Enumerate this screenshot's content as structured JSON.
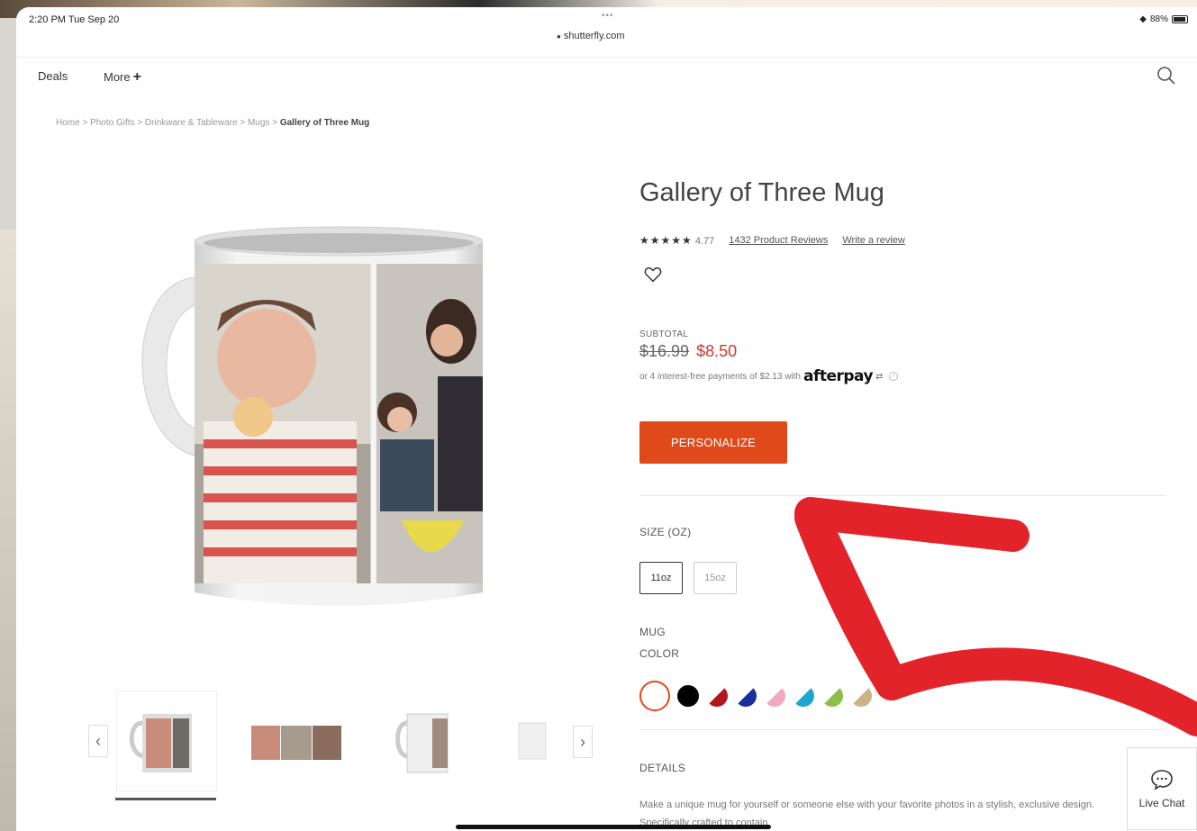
{
  "status": {
    "time": "2:20 PM  Tue Sep 20",
    "dots": "•••",
    "url": "shutterfly.com",
    "battery": "88%"
  },
  "nav": {
    "deals": "Deals",
    "more": "More"
  },
  "breadcrumb": {
    "path": "Home > Photo Gifts > Drinkware & Tableware > Mugs > ",
    "current": "Gallery of Three Mug"
  },
  "product": {
    "title": "Gallery of Three Mug",
    "stars": "★★★★★",
    "rating": "4.77",
    "reviews_link": "1432 Product Reviews",
    "write_review": "Write a review",
    "subtotal_label": "SUBTOTAL",
    "price_old": "$16.99",
    "price_new": "$8.50",
    "afterpay_text": "or 4 interest-free payments of $2.13 with",
    "afterpay_brand": "afterpay",
    "personalize": "PERSONALIZE",
    "size_label": "SIZE (OZ)",
    "sizes": [
      "11oz",
      "15oz"
    ],
    "selected_size": "11oz",
    "color_label_line1": "MUG",
    "color_label_line2": "COLOR",
    "colors": [
      "#ffffff",
      "#000000",
      "#b3161d",
      "#1a2f9e",
      "#f4a7c0",
      "#1fa6cf",
      "#8bbf4a",
      "#c9b48a"
    ],
    "selected_color": "#ffffff",
    "details_label": "DETAILS",
    "details_text": "Make a unique mug for yourself or someone else with your favorite photos in a stylish, exclusive design. Specifically crafted to contain"
  },
  "livechat": {
    "label": "Live Chat"
  },
  "annotation_color": "#e2232a",
  "accent_color": "#e04a1a"
}
